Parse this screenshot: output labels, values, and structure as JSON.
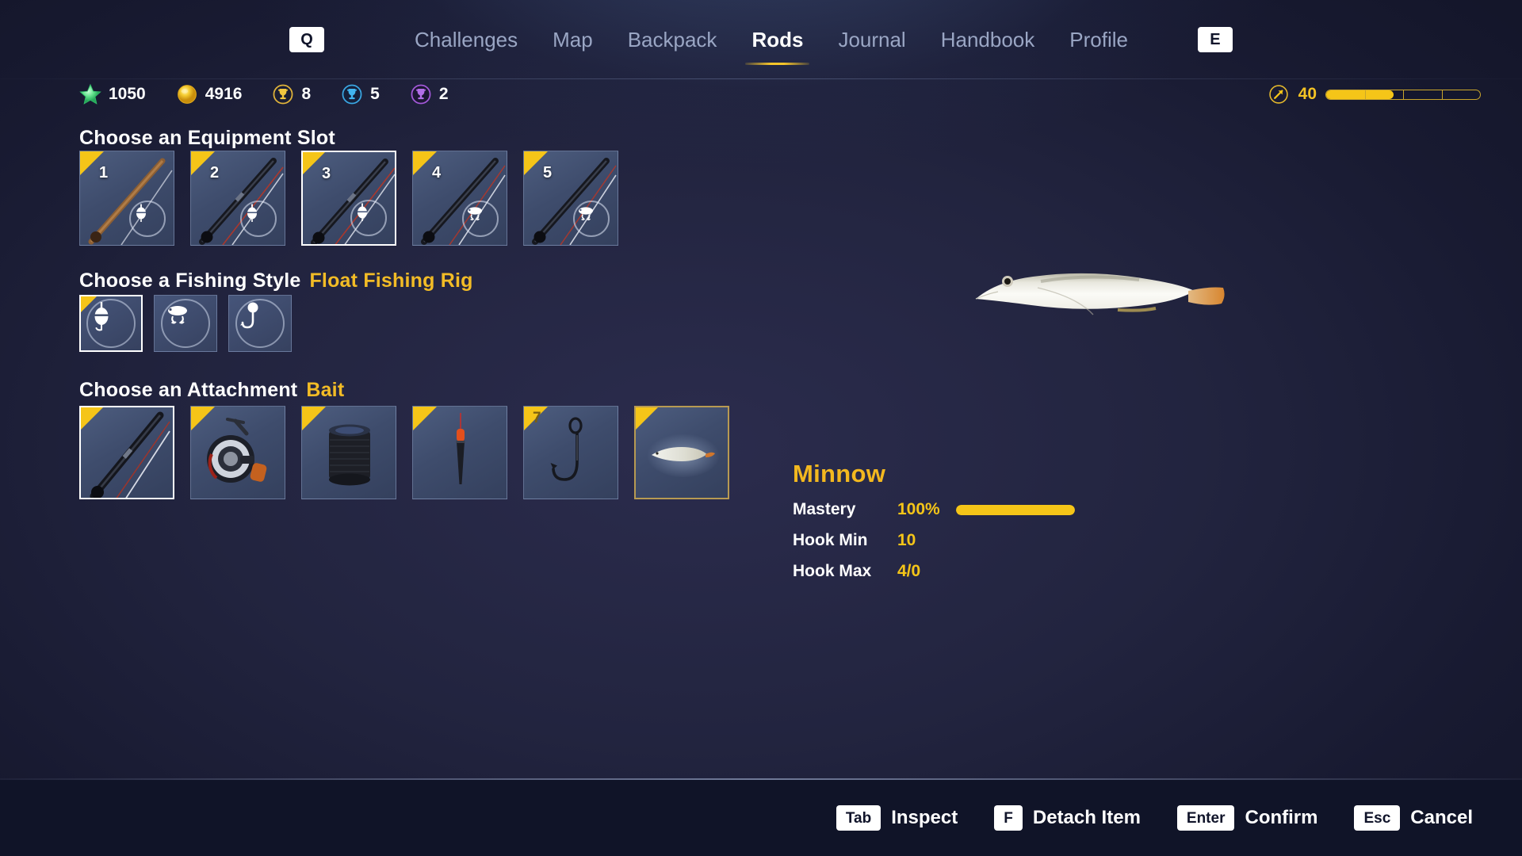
{
  "nav": {
    "left_key": "Q",
    "right_key": "E",
    "items": [
      {
        "label": "Challenges",
        "active": false
      },
      {
        "label": "Map",
        "active": false
      },
      {
        "label": "Backpack",
        "active": false
      },
      {
        "label": "Rods",
        "active": true
      },
      {
        "label": "Journal",
        "active": false
      },
      {
        "label": "Handbook",
        "active": false
      },
      {
        "label": "Profile",
        "active": false
      }
    ]
  },
  "stats": {
    "items": [
      {
        "icon": "green-star-icon",
        "value": "1050",
        "color": "#4fd47a"
      },
      {
        "icon": "gold-coin-icon",
        "value": "4916",
        "color": "#f2c520"
      },
      {
        "icon": "gold-trophy-icon",
        "value": "8",
        "color": "#e8b834"
      },
      {
        "icon": "blue-trophy-icon",
        "value": "5",
        "color": "#37a8e0"
      },
      {
        "icon": "purple-trophy-icon",
        "value": "2",
        "color": "#a357d6"
      }
    ],
    "xp": {
      "icon": "level-arrow-icon",
      "level": "40",
      "fill_percent": 44,
      "segments": 4
    }
  },
  "sections": {
    "equipment": {
      "title": "Choose an Equipment Slot",
      "slots": [
        {
          "number": "1",
          "item": "fishing-rod-brown",
          "badge": "float-icon",
          "selected": false,
          "corner": true
        },
        {
          "number": "2",
          "item": "fishing-rod-black",
          "badge": "float-icon",
          "selected": false,
          "corner": true
        },
        {
          "number": "3",
          "item": "fishing-rod-black",
          "badge": "float-icon",
          "selected": true,
          "corner": true
        },
        {
          "number": "4",
          "item": "fishing-rod-black",
          "badge": "lure-icon",
          "selected": false,
          "corner": true
        },
        {
          "number": "5",
          "item": "fishing-rod-black",
          "badge": "lure-icon",
          "selected": false,
          "corner": true
        }
      ]
    },
    "style": {
      "title": "Choose a Fishing Style",
      "subtitle": "Float Fishing Rig",
      "options": [
        {
          "icon": "float-bobber-icon",
          "selected": true,
          "corner": true
        },
        {
          "icon": "crankbait-lure-icon",
          "selected": false,
          "corner": false
        },
        {
          "icon": "jig-head-hook-icon",
          "selected": false,
          "corner": false
        }
      ]
    },
    "attachment": {
      "title": "Choose an Attachment",
      "subtitle": "Bait",
      "slots": [
        {
          "number": "",
          "item": "rod-icon",
          "selected": true,
          "highlighted": false,
          "corner": true
        },
        {
          "number": "",
          "item": "reel-icon",
          "selected": false,
          "highlighted": false,
          "corner": true
        },
        {
          "number": "",
          "item": "line-spool-icon",
          "selected": false,
          "highlighted": false,
          "corner": true
        },
        {
          "number": "",
          "item": "float-icon",
          "selected": false,
          "highlighted": false,
          "corner": true
        },
        {
          "number": "7",
          "item": "hook-icon",
          "selected": false,
          "highlighted": false,
          "corner": true
        },
        {
          "number": "",
          "item": "minnow-bait-icon",
          "selected": false,
          "highlighted": true,
          "corner": true
        }
      ]
    }
  },
  "preview": {
    "item": "minnow-fish-image"
  },
  "detail": {
    "name": "Minnow",
    "rows": [
      {
        "label": "Mastery",
        "value": "100%",
        "bar": 100
      },
      {
        "label": "Hook Min",
        "value": "10",
        "bar": null
      },
      {
        "label": "Hook Max",
        "value": "4/0",
        "bar": null
      }
    ]
  },
  "footer": {
    "actions": [
      {
        "key": "Tab",
        "label": "Inspect"
      },
      {
        "key": "F",
        "label": "Detach Item"
      },
      {
        "key": "Enter",
        "label": "Confirm"
      },
      {
        "key": "Esc",
        "label": "Cancel"
      }
    ]
  },
  "colors": {
    "accent": "#f5c518",
    "gold_text": "#f3b81f",
    "nav_inactive": "#9aa6c4"
  }
}
